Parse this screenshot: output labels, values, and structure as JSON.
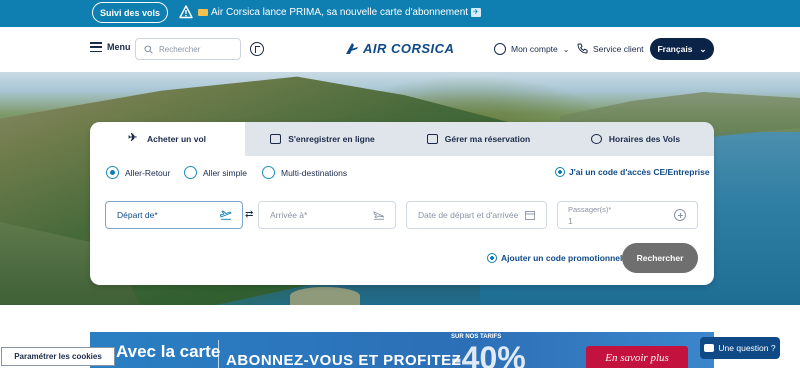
{
  "topbar": {
    "tracking_label": "Suivi des vols",
    "announcement": "Air Corsica lance PRIMA, sa nouvelle carte d'abonnement",
    "icons": [
      "warning-icon",
      "card-icon",
      "airplane-icon"
    ]
  },
  "header": {
    "menu_label": "Menu",
    "search_placeholder": "Rechercher",
    "logo_text": "AIR CORSICA",
    "account_label": "Mon compte",
    "service_label": "Service client",
    "language": "Français"
  },
  "booking": {
    "tabs": [
      {
        "label": "Acheter un vol",
        "icon": "airplane-icon"
      },
      {
        "label": "S'enregistrer en ligne",
        "icon": "ticket-icon"
      },
      {
        "label": "Gérer ma réservation",
        "icon": "calendar-icon"
      },
      {
        "label": "Horaires des Vols",
        "icon": "clock-icon"
      }
    ],
    "trip_types": [
      "Aller-Retour",
      "Aller simple",
      "Multi-destinations"
    ],
    "selected_trip": "Aller-Retour",
    "access_code_label": "J'ai un code d'accès CE/Entreprise",
    "fields": {
      "departure": "Départ de*",
      "arrival": "Arrivée à*",
      "dates": "Date de départ et d'arrivée",
      "passengers_label": "Passager(s)*",
      "passengers_value": "1"
    },
    "promo_label": "Ajouter un code promotionnel",
    "search_button": "Rechercher"
  },
  "banner": {
    "text_left": "Avec la carte",
    "text_main": "ABONNEZ-VOUS ET PROFITEZ",
    "small": "SUR NOS TARIFS",
    "percent": "-40%",
    "more_button": "En savoir plus"
  },
  "cookies_button": "Paramétrer les cookies",
  "question_button": "Une question ?",
  "colors": {
    "topbar": "#0f7eb0",
    "navy": "#0b2347",
    "brand": "#0f4a86",
    "search_button": "#6f6f6f",
    "cta_red": "#c4123f"
  }
}
